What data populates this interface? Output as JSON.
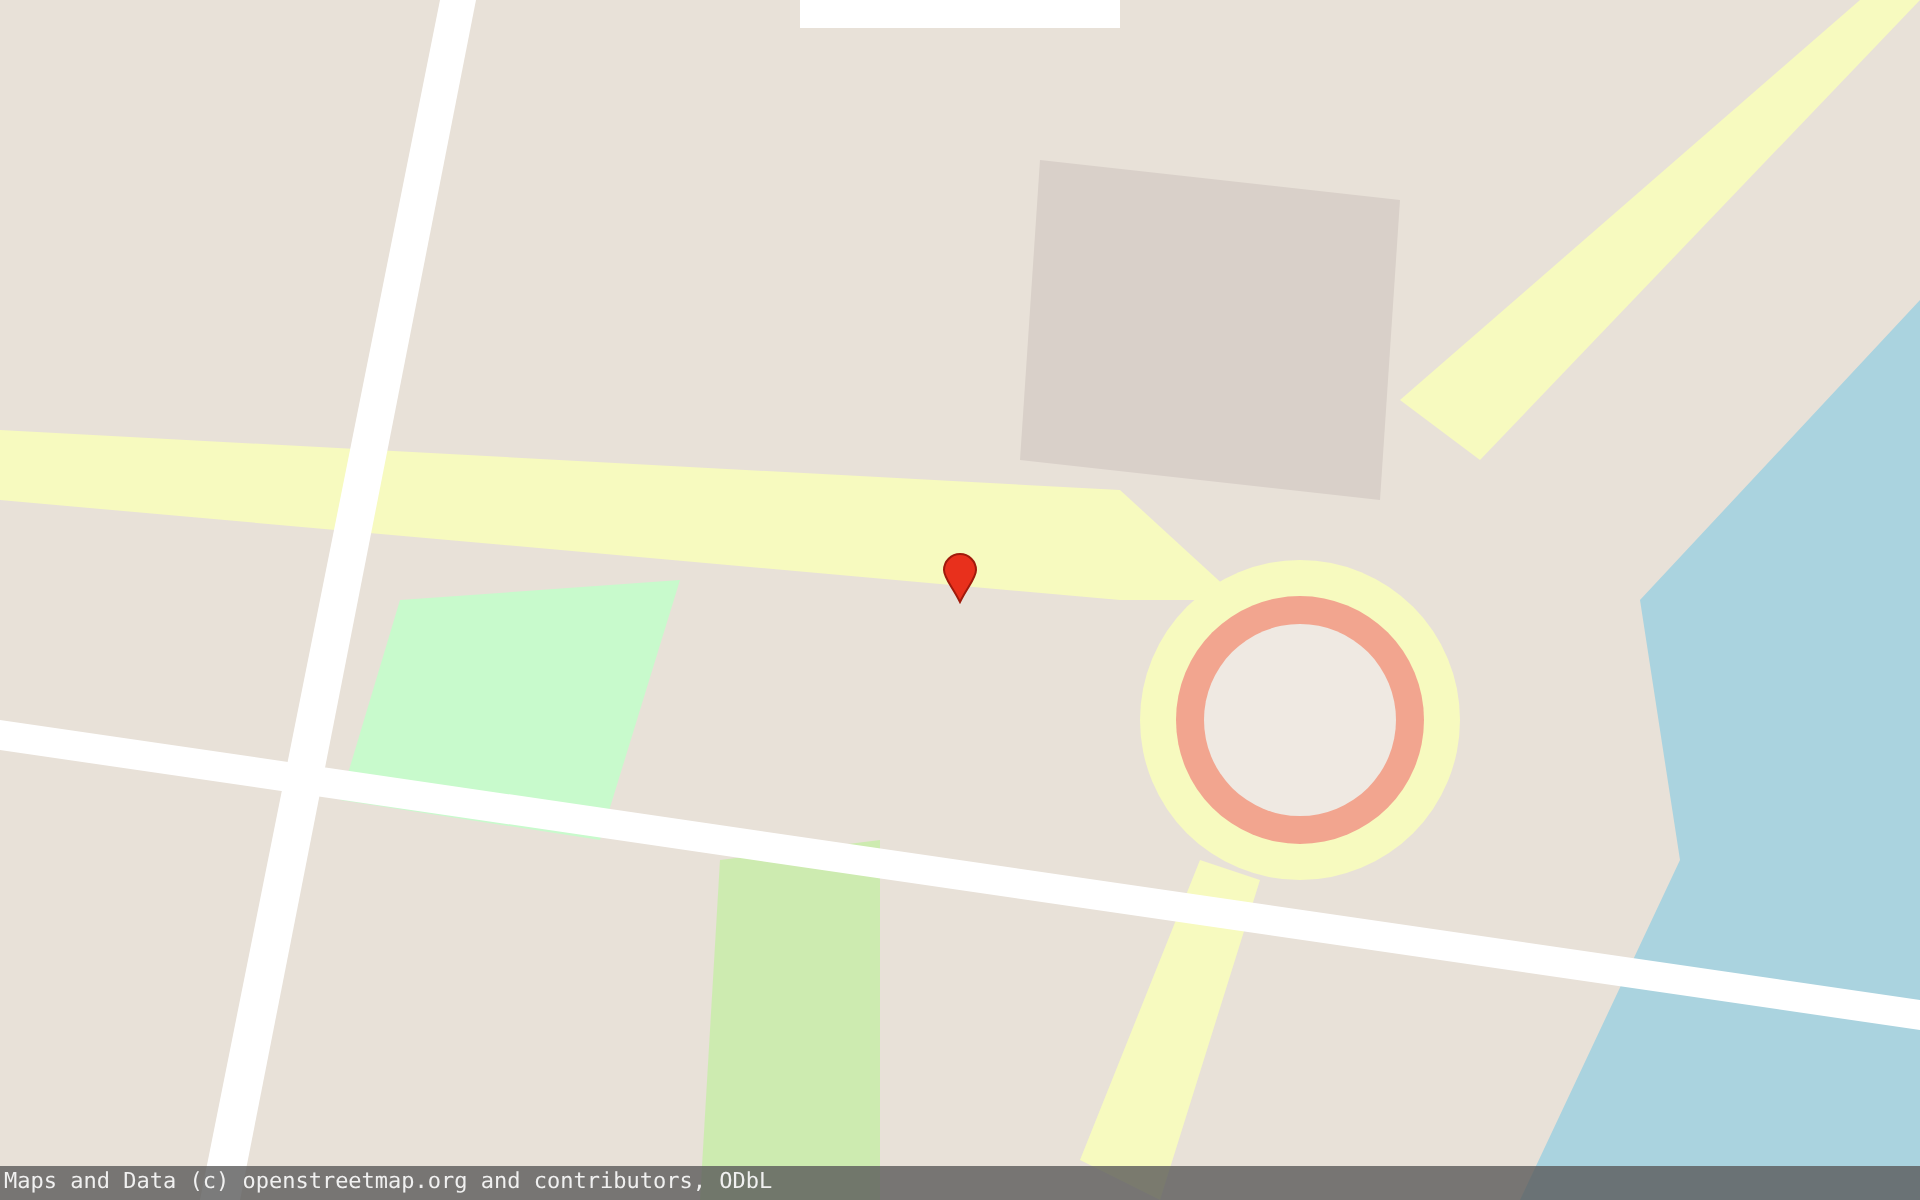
{
  "attribution": "Maps and Data (c) openstreetmap.org and contributors, ODbL"
}
